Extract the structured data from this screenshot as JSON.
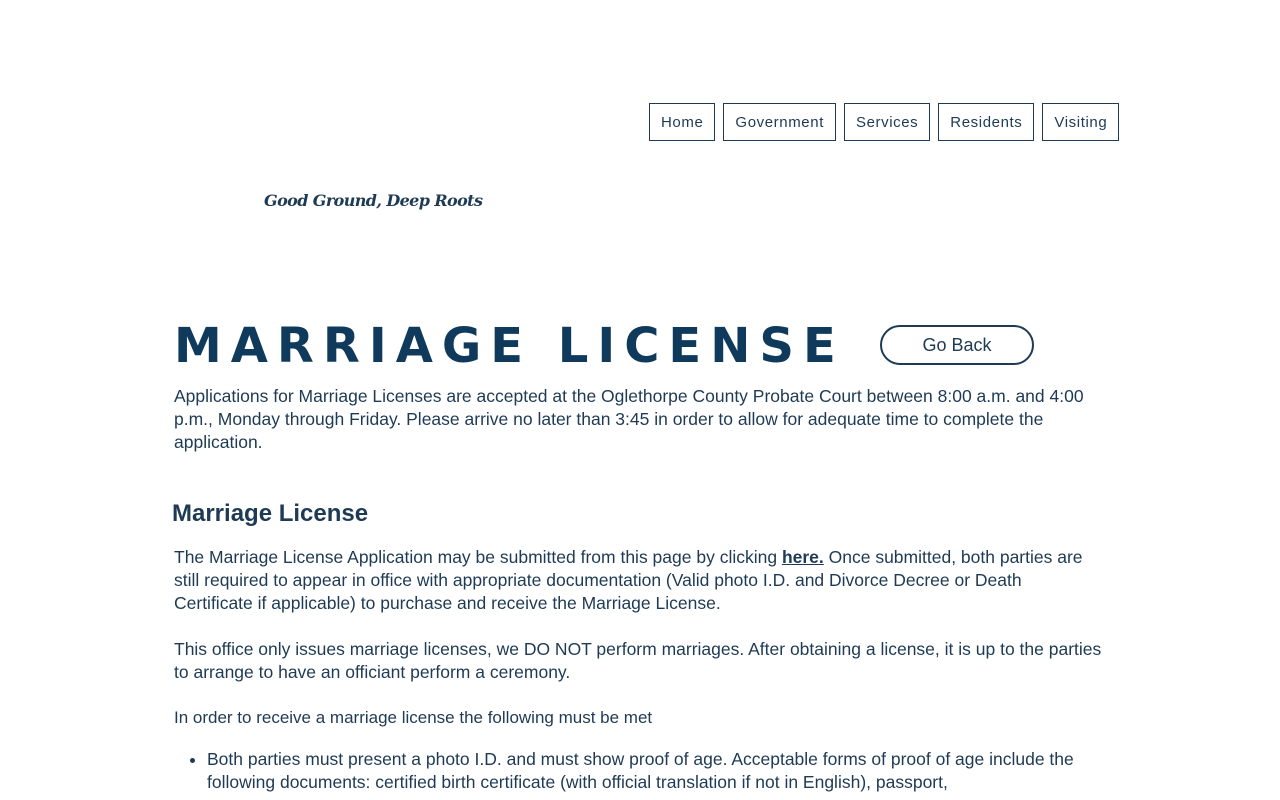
{
  "nav": {
    "items": [
      "Home",
      "Government",
      "Services",
      "Residents",
      "Visiting"
    ]
  },
  "tagline": "Good Ground, Deep Roots",
  "page": {
    "title": "MARRIAGE LICENSE",
    "go_back_label": "Go Back",
    "intro": "Applications for Marriage Licenses are accepted at the Oglethorpe County Probate Court between 8:00 a.m. and 4:00 p.m., Monday through Friday. Please arrive no later than 3:45 in order to allow for adequate time to complete the application."
  },
  "section": {
    "heading": "Marriage License",
    "p1_before": "The Marriage License Application may be submitted from this page by clicking ",
    "p1_link": "here.",
    "p1_after": " Once submitted, both parties are still required to appear in office with appropriate documentation (Valid photo I.D. and Divorce Decree or Death Certificate if applicable) to purchase and receive the Marriage License.",
    "p2": "This office only issues marriage licenses, we DO NOT perform marriages. After obtaining a license, it is up to the parties to arrange to have an officiant perform a ceremony.",
    "p3": "In order to receive a marriage license the following must be met",
    "requirements": [
      "Both parties must present a photo I.D. and must show proof of age. Acceptable forms of proof of age include the following documents: certified birth certificate (with official translation if not in English), passport,"
    ]
  }
}
